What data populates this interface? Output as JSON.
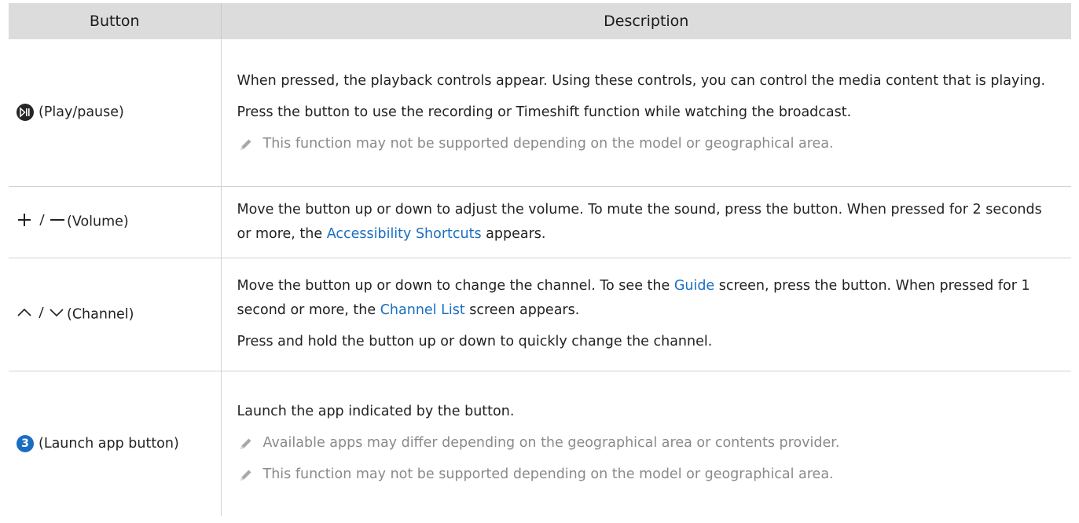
{
  "header": {
    "col_button": "Button",
    "col_description": "Description"
  },
  "rows": [
    {
      "button_label": "(Play/pause)",
      "icon": "play-pause-icon",
      "paragraphs": [
        "When pressed, the playback controls appear. Using these controls, you can control the media content that is playing.",
        "Press the button to use the recording or Timeshift function while watching the broadcast."
      ],
      "notes": [
        "This function may not be supported depending on the model or geographical area."
      ]
    },
    {
      "button_label": "(Volume)",
      "icon": "volume-plus-minus-icon",
      "text_a": "Move the button up or down to adjust the volume. To mute the sound, press the button. When pressed for 2 seconds or more, the ",
      "link_a": "Accessibility Shortcuts",
      "text_b": " appears."
    },
    {
      "button_label": "(Channel)",
      "icon": "channel-up-down-icon",
      "text_a": "Move the button up or down to change the channel. To see the ",
      "link_a": "Guide",
      "text_b": " screen, press the button. When pressed for 1 second or more, the ",
      "link_b": "Channel List",
      "text_c": " screen appears.",
      "paragraph2": "Press and hold the button up or down to quickly change the channel."
    },
    {
      "button_label": "(Launch app button)",
      "icon": "launch-app-3-icon",
      "icon_number": "3",
      "paragraphs": [
        "Launch the app indicated by the button."
      ],
      "notes": [
        "Available apps may differ depending on the geographical area or contents provider.",
        "This function may not be supported depending on the model or geographical area."
      ]
    }
  ],
  "colors": {
    "link": "#1a6ec2",
    "header_bg": "#dcdcdc",
    "note_text": "#8a8a8a"
  }
}
